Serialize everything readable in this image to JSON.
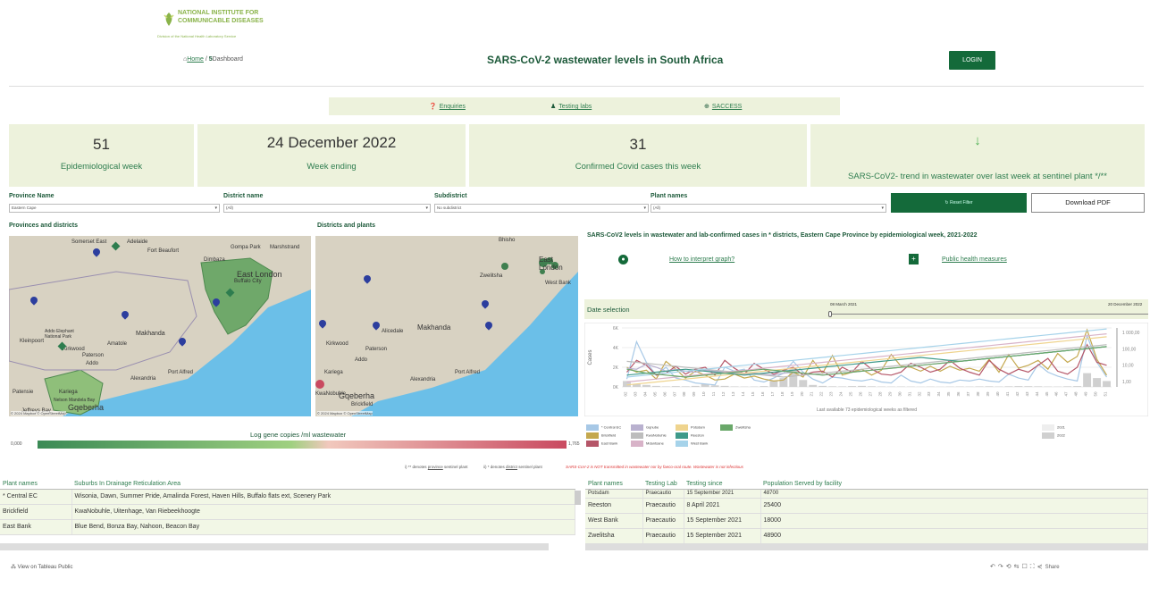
{
  "header": {
    "logo_title": "NATIONAL INSTITUTE FOR COMMUNICABLE DISEASES",
    "logo_sub": "Division of the National Health Laboratory Service",
    "breadcrumb_home": "Home",
    "breadcrumb_sep": " / ",
    "breadcrumb_current": "Dashboard",
    "title": "SARS-CoV-2 wastewater levels in South Africa",
    "login": "LOGIN"
  },
  "links": [
    "Enquiries",
    "Testing labs",
    "SACCESS"
  ],
  "kpis": [
    {
      "value": "51",
      "label": "Epidemiological week"
    },
    {
      "value": "24 December 2022",
      "label": "Week ending"
    },
    {
      "value": "31",
      "label": "Confirmed Covid cases this week"
    },
    {
      "value": "↓",
      "label": "SARS-CoV2- trend in wastewater over last week at sentinel plant */**"
    }
  ],
  "filters": [
    {
      "label": "Province Name",
      "value": "Eastern Cape"
    },
    {
      "label": "District name",
      "value": "(All)"
    },
    {
      "label": "Subdistrict",
      "value": "No subdistrict"
    },
    {
      "label": "Plant names",
      "value": "(All)"
    }
  ],
  "reset_filter": "Reset Filter",
  "download_pdf": "Download PDF",
  "maps": {
    "left_title": "Provinces and districts",
    "right_title": "Districts and plants",
    "credit": "© 2024 Mapbox © OpenStreetMap",
    "left_labels": [
      "Somerset East",
      "Adelaide",
      "Fort Beaufort",
      "Gompa Park",
      "Marshstrand",
      "Dimbaza",
      "East London",
      "Buffalo City",
      "Makhanda",
      "Addo Elephant National Park",
      "Kleinpoort",
      "Kirkwood",
      "Paterson",
      "Addo",
      "Alexandria",
      "Port Alfred",
      "Patensie",
      "Kariega",
      "Nelson Mandela Bay",
      "Gqeberha",
      "Jeffreys Bay",
      "Amatole"
    ],
    "right_labels": [
      "Bhisho",
      "Zwelitsha",
      "East London",
      "West Bank",
      "Makhanda",
      "Alicedale",
      "Kirkwood",
      "Paterson",
      "Addo",
      "Alexandria",
      "Port Alfred",
      "Kariega",
      "KwaNobuhle",
      "Gqeberha",
      "Brickfield"
    ]
  },
  "legend": {
    "title": "Log gene copies /ml wastewater",
    "min": "0,000",
    "max": "1,765"
  },
  "notes": {
    "n1_pre": "i) ** denotes ",
    "n1_link": "province",
    "n1_post": " sentinel plant",
    "n2_pre": "ii) * denotes ",
    "n2_link": "district",
    "n2_post": " sentinel plant",
    "warning": "SARS-CoV-2 is NOT transmitted in wastewater nor by faeco-oral route. Wastewater is not infectious"
  },
  "chart": {
    "title": "SARS-CoV2 levels in wastewater and lab-confirmed cases in * districts, Eastern Cape Province by epidemiological week, 2021-2022",
    "how_to": "How to interpret graph?",
    "measures": "Public health measures",
    "date_selection": "Date selection",
    "date_start": "08 March 2021",
    "date_end": "20 December 2022",
    "footer": "Last available 73 epidemiological weeks as filtered",
    "legend_extra": [
      "2021",
      "2022"
    ]
  },
  "chart_data": {
    "type": "line",
    "ylabel": "Cases",
    "yticks": [
      "0K",
      "2K",
      "4K",
      "6K"
    ],
    "y2ticks": [
      "1,00",
      "10,00",
      "100,00",
      "1 000,00"
    ],
    "ylim": [
      0,
      6000
    ],
    "categories": [
      "02",
      "03",
      "04",
      "05",
      "06",
      "07",
      "08",
      "09",
      "10",
      "11",
      "12",
      "13",
      "14",
      "15",
      "16",
      "17",
      "18",
      "19",
      "20",
      "21",
      "22",
      "23",
      "24",
      "25",
      "26",
      "27",
      "28",
      "29",
      "30",
      "31",
      "32",
      "33",
      "34",
      "35",
      "36",
      "37",
      "38",
      "39",
      "40",
      "41",
      "42",
      "43",
      "44",
      "45",
      "46",
      "47",
      "48",
      "49",
      "50",
      "51"
    ],
    "bars_2021": [
      600,
      300,
      200,
      100,
      50,
      80,
      60,
      100,
      300,
      150,
      100,
      50,
      30,
      40,
      80,
      600,
      900,
      1900,
      700,
      200,
      100,
      60,
      50,
      80,
      100,
      60,
      40,
      30,
      40,
      30,
      20,
      30,
      20,
      30,
      40,
      30,
      50,
      60,
      40,
      60,
      80,
      70,
      60,
      40,
      30,
      60,
      80,
      1400,
      900,
      600
    ],
    "series": [
      {
        "name": "* Central EC",
        "color": "#a7c8e6",
        "values": [
          800,
          4600,
          2500,
          1200,
          2000,
          900,
          700,
          400,
          300,
          200,
          2000,
          1600,
          1800,
          700,
          500,
          900,
          1400,
          2600,
          1500,
          800,
          400,
          1000,
          900,
          700,
          600,
          800,
          500,
          400,
          1200,
          600,
          400,
          800,
          500,
          400,
          700,
          600,
          800,
          600,
          500,
          1300,
          900,
          700,
          2300,
          1500,
          1100,
          800,
          600,
          5200,
          2500,
          1000
        ]
      },
      {
        "name": "Brickfield",
        "color": "#c4a84e",
        "values": [
          2000,
          1500,
          1700,
          800,
          2600,
          1800,
          900,
          1600,
          1200,
          700,
          800,
          1300,
          900,
          1100,
          800,
          600,
          700,
          1500,
          1000,
          2700,
          1400,
          3200,
          1200,
          1500,
          1800,
          1200,
          1700,
          3300,
          2100,
          2000,
          1600,
          2100,
          1600,
          2100,
          1700,
          1900,
          1600,
          2800,
          1500,
          3300,
          1900,
          2200,
          2700,
          1800,
          3400,
          2500,
          3100,
          5800,
          2800,
          1200
        ]
      },
      {
        "name": "East Bank",
        "color": "#b55668",
        "values": [
          1500,
          2700,
          2200,
          1200,
          1400,
          2100,
          1300,
          1800,
          2000,
          1200,
          2700,
          1900,
          1300,
          2400,
          1800,
          1300,
          1700,
          2000,
          1200,
          1500,
          1600,
          1000,
          2000,
          1500,
          2600,
          1800,
          1300,
          1200,
          1500,
          2400,
          2000,
          1500,
          1800,
          2700,
          1900,
          1500,
          1200,
          2700,
          1800,
          1300,
          1800,
          1500,
          2200,
          2900,
          1600,
          1300,
          2000,
          4300,
          2500,
          2200
        ]
      },
      {
        "name": "Gqnube",
        "color": "#b9b1cf",
        "values": [
          1900,
          1800,
          2300,
          2000,
          1600,
          1800,
          1600,
          1500,
          1700,
          1600,
          1500,
          1400,
          1300,
          1400,
          1300,
          1200,
          1400,
          1500,
          1400,
          1300,
          1200,
          1300,
          1400,
          1500,
          1600,
          1700,
          1800,
          1900,
          2000,
          2100,
          2200,
          2300,
          2400,
          2500,
          2600,
          2700,
          2800,
          2900,
          3000,
          3100,
          3200,
          3300,
          3400,
          3500,
          3600,
          3700,
          3800,
          3900,
          4000,
          4100
        ]
      },
      {
        "name": "KwaNobuhle",
        "color": "#bdbdbd",
        "values": [
          2600,
          2500,
          2400,
          2300,
          2200,
          2100,
          2000,
          1900,
          1800,
          1700,
          1600,
          1500,
          1400,
          1300,
          1200,
          1100,
          1000,
          1100,
          1200,
          1300,
          1400,
          1500,
          1600,
          1700,
          1800,
          1900,
          2000,
          2100,
          2200,
          2300,
          2400,
          2500,
          2600,
          2700,
          2800,
          2900,
          3000,
          3100,
          3200,
          3300,
          3400,
          3500,
          3600,
          3700,
          3800,
          3900,
          4000,
          4100,
          4200,
          4300
        ]
      },
      {
        "name": "Mdantsane",
        "color": "#d8b3c8",
        "values": [
          500,
          600,
          700,
          800,
          900,
          1000,
          1100,
          1200,
          1300,
          1400,
          1500,
          1600,
          1700,
          1800,
          1900,
          2000,
          2100,
          2200,
          2300,
          2400,
          2500,
          2600,
          2700,
          2800,
          2900,
          3000,
          3100,
          3200,
          3300,
          3400,
          3500,
          3600,
          3700,
          3800,
          3900,
          4000,
          4100,
          4200,
          4300,
          4400,
          4500,
          4600,
          4700,
          4800,
          4900,
          5000,
          5100,
          5200,
          5300,
          5400
        ]
      },
      {
        "name": "Potsdam",
        "color": "#efd48e",
        "values": [
          200,
          300,
          400,
          500,
          600,
          700,
          800,
          900,
          1000,
          1100,
          1200,
          1300,
          1400,
          1500,
          1600,
          1700,
          1800,
          1900,
          2000,
          2100,
          2200,
          2300,
          2400,
          2500,
          2600,
          2700,
          2800,
          2900,
          3000,
          3100,
          3200,
          3300,
          3400,
          3500,
          3600,
          3700,
          3800,
          3900,
          4000,
          4100,
          4200,
          4300,
          4400,
          4500,
          4600,
          4700,
          4800,
          4900,
          5000,
          5100
        ]
      },
      {
        "name": "Reeston",
        "color": "#3f9a8a",
        "values": [
          1200,
          1300,
          1400,
          1500,
          1600,
          1700,
          1800,
          1700,
          1600,
          1500,
          1400,
          1300,
          1200,
          1300,
          1400,
          1500,
          1600,
          1700,
          1800,
          1900,
          2000,
          2100,
          2200,
          2300,
          2400,
          2500,
          2600,
          2700,
          2800,
          2900,
          3000,
          2900,
          2800,
          2700,
          2600,
          2700,
          2800,
          2900,
          3000,
          3100,
          3200,
          3300,
          3400,
          3500,
          3600,
          3700,
          3800,
          3900,
          4000,
          4100
        ]
      },
      {
        "name": "West Bank",
        "color": "#a6d3ea",
        "values": [
          1000,
          1100,
          1200,
          1300,
          1400,
          1500,
          1600,
          1700,
          1800,
          1900,
          2000,
          2100,
          2200,
          2300,
          2400,
          2500,
          2600,
          2700,
          2800,
          2900,
          3000,
          3100,
          3200,
          3300,
          3400,
          3500,
          3600,
          3700,
          3800,
          3900,
          4000,
          4100,
          4200,
          4300,
          4400,
          4500,
          4600,
          4700,
          4800,
          4900,
          5000,
          5100,
          5200,
          5300,
          5400,
          5500,
          5600,
          5700,
          5800,
          5900
        ]
      },
      {
        "name": "Zwelitsha",
        "color": "#6aa86a",
        "values": [
          1800,
          1600,
          1400,
          1300,
          1200,
          1100,
          1000,
          1100,
          1200,
          1300,
          1400,
          1500,
          1600,
          1700,
          1800,
          1700,
          1600,
          1500,
          1400,
          1300,
          1200,
          1300,
          1400,
          1500,
          1600,
          1700,
          1800,
          1900,
          2000,
          2100,
          2200,
          2300,
          2400,
          2500,
          2600,
          2700,
          2800,
          2900,
          3000,
          3100,
          3200,
          3300,
          3400,
          3500,
          3600,
          3700,
          3800,
          3900,
          4000,
          4100
        ]
      }
    ]
  },
  "table_left": {
    "headers": [
      "Plant names",
      "Suburbs In Drainage Reticulation Area"
    ],
    "rows": [
      [
        "* Central EC",
        "Wisonia, Dawn, Summer Pride, Amalinda Forest, Haven Hills, Buffalo flats ext, Scenery Park"
      ],
      [
        "Brickfield",
        "KwaNobuhle, Uitenhage, Van Riebeekhoogte"
      ],
      [
        "East Bank",
        "Blue Bend, Bonza Bay, Nahoon, Beacon Bay"
      ]
    ]
  },
  "table_right": {
    "headers": [
      "Plant names",
      "Testing Lab",
      "Testing since",
      "Population Served by facility"
    ],
    "rows": [
      [
        "Potsdam",
        "Praecautio",
        "15 September 2021",
        "48700"
      ],
      [
        "Reeston",
        "Praecautio",
        "8 April 2021",
        "25400"
      ],
      [
        "West Bank",
        "Praecautio",
        "15 September 2021",
        "18000"
      ],
      [
        "Zwelitsha",
        "Praecautio",
        "15 September 2021",
        "48900"
      ]
    ]
  },
  "footer": {
    "left": "View on Tableau Public",
    "right": "Share"
  },
  "colors": {
    "accent": "#146a3a",
    "panel": "#edf2dc"
  }
}
